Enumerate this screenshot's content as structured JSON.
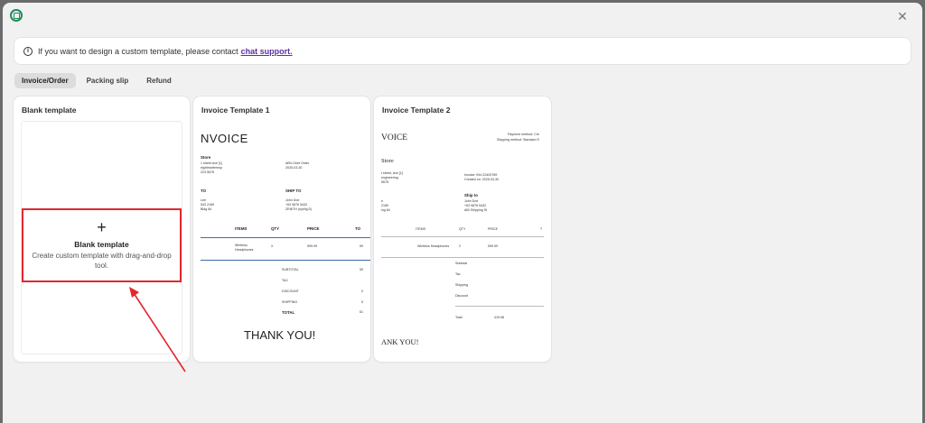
{
  "banner": {
    "text": "If you want to design a custom template, please contact",
    "link": "chat support."
  },
  "tabs": [
    {
      "label": "Invoice/Order",
      "active": true
    },
    {
      "label": "Packing slip",
      "active": false
    },
    {
      "label": "Refund",
      "active": false
    }
  ],
  "blank_card": {
    "title": "Blank template",
    "plus": "+",
    "heading": "Blank template",
    "description": "Create custom template with drag-and-drop tool."
  },
  "template1": {
    "title": "Invoice Template 1",
    "heading": "NVOICE",
    "store": "Store",
    "store_lines": [
      "1 street Ave [1]",
      "eightmarternsp",
      "224 5678"
    ],
    "order_lines": [
      "ABV-Onet Order",
      "2025-03-30"
    ],
    "bill_to": "TO",
    "ship_to": "SHIP TO",
    "bill_lines": [
      "Lee",
      "543 2189",
      "Bldg 84"
    ],
    "ship_lines": [
      "John Doe",
      "+63 9876 5432",
      "ZENITH (eyelig D)"
    ],
    "cols": [
      "ITEMS",
      "QTY",
      "PRICE",
      "TO"
    ],
    "item_name": "Wireless",
    "item_name2": "Headphones",
    "item_qty": "X",
    "item_price": "599.99",
    "item_total": "59",
    "totals": [
      "SUBTOTAL",
      "TAX",
      "DISCOUNT",
      "SHIPPING",
      "TOTAL"
    ],
    "total_vals": [
      "59",
      "",
      "0",
      "5",
      "61"
    ],
    "thanks": "THANK YOU!"
  },
  "template2": {
    "title": "Invoice Template 2",
    "heading": "VOICE",
    "top_right": [
      "Payment method: Cre",
      "Shipping method: Standard S"
    ],
    "store": "Store",
    "store_lines": [
      "t street, Ave [1]",
      "engineering",
      "5678"
    ],
    "order_lines": [
      "Invoice: INV-22400789",
      "Created on: 2025-03-30"
    ],
    "ship_to": "Ship to",
    "ship_lines": [
      "John Doe",
      "+63 9876 5432",
      "ABI Shipping St"
    ],
    "bill_lines": [
      "e",
      "2189",
      "ing 84"
    ],
    "cols": [
      "ITEMS",
      "QTY",
      "PRICE",
      "T"
    ],
    "item_name": "Wireless Headphones",
    "item_qty": "2",
    "item_price": "599.99",
    "totals": [
      "Subtotal",
      "Tax",
      "Shipping",
      "Discount"
    ],
    "total_label": "Total",
    "total_val": "419.98",
    "thanks": "ANK YOU!"
  },
  "colors": {
    "accent": "#5b2fa3",
    "highlight": "#e3262f",
    "brand": "#1e8b5a"
  }
}
